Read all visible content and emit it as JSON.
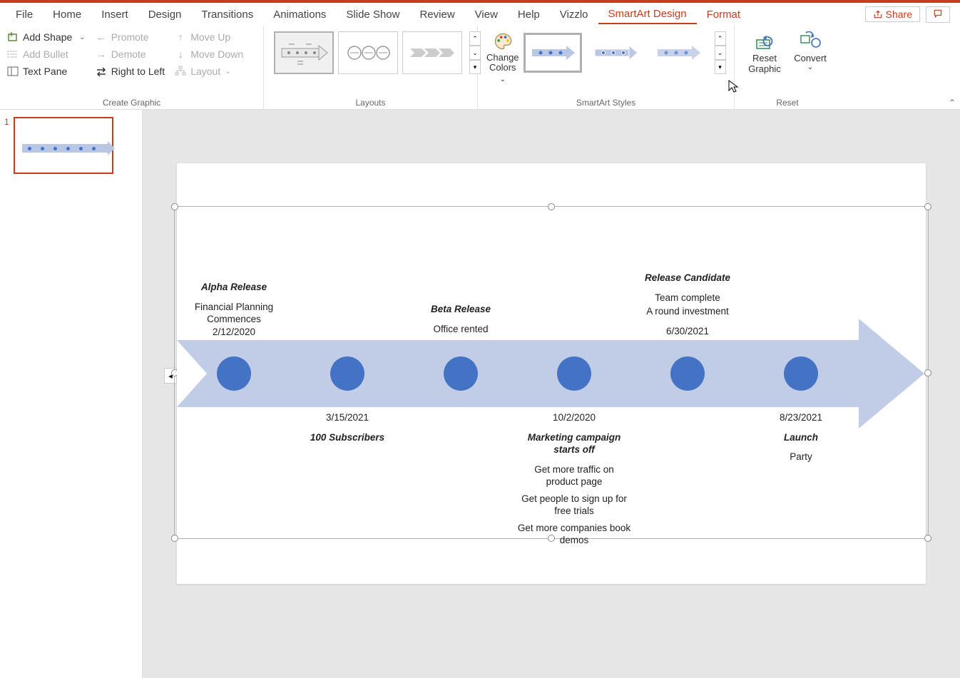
{
  "tabs": {
    "file": "File",
    "home": "Home",
    "insert": "Insert",
    "design": "Design",
    "transitions": "Transitions",
    "animations": "Animations",
    "slideshow": "Slide Show",
    "review": "Review",
    "view": "View",
    "help": "Help",
    "vizzlo": "Vizzlo",
    "smartart": "SmartArt Design",
    "format": "Format"
  },
  "share": "Share",
  "ribbon": {
    "create_graphic": {
      "add_shape": "Add Shape",
      "add_bullet": "Add Bullet",
      "text_pane": "Text Pane",
      "promote": "Promote",
      "demote": "Demote",
      "rtl": "Right to Left",
      "move_up": "Move Up",
      "move_down": "Move Down",
      "layout": "Layout",
      "label": "Create Graphic"
    },
    "layouts": {
      "label": "Layouts"
    },
    "styles": {
      "change_colors": "Change Colors",
      "label": "SmartArt Styles"
    },
    "reset": {
      "reset_graphic_l1": "Reset",
      "reset_graphic_l2": "Graphic",
      "convert": "Convert",
      "label": "Reset"
    }
  },
  "thumb": {
    "num": "1"
  },
  "timeline": {
    "m0": {
      "title": "Alpha Release",
      "line1": "Financial Planning Commences",
      "date": "2/12/2020"
    },
    "m1": {
      "date": "3/15/2021",
      "title": "100 Subscribers"
    },
    "m2": {
      "title": "Beta Release",
      "line1": "Office rented"
    },
    "m3": {
      "date": "10/2/2020",
      "title": "Marketing campaign starts off",
      "b1": "Get more traffic on product page",
      "b2": "Get people to sign up for free trials",
      "b3": "Get more companies book demos"
    },
    "m4": {
      "title": "Release Candidate",
      "line1": "Team complete",
      "line2": "A round investment",
      "date": "6/30/2021"
    },
    "m5": {
      "date": "8/23/2021",
      "title": "Launch",
      "line1": "Party"
    }
  },
  "chart_data": {
    "type": "timeline",
    "title": "",
    "milestones": [
      {
        "label_position": "above",
        "title": "Alpha Release",
        "date": "2/12/2020",
        "details": [
          "Financial Planning Commences"
        ]
      },
      {
        "label_position": "below",
        "title": "100 Subscribers",
        "date": "3/15/2021",
        "details": []
      },
      {
        "label_position": "above",
        "title": "Beta Release",
        "date": "",
        "details": [
          "Office rented"
        ]
      },
      {
        "label_position": "below",
        "title": "Marketing campaign starts off",
        "date": "10/2/2020",
        "details": [
          "Get more traffic on product page",
          "Get people to sign up for free trials",
          "Get more companies book demos"
        ]
      },
      {
        "label_position": "above",
        "title": "Release Candidate",
        "date": "6/30/2021",
        "details": [
          "Team complete",
          "A round investment"
        ]
      },
      {
        "label_position": "below",
        "title": "Launch",
        "date": "8/23/2021",
        "details": [
          "Party"
        ]
      }
    ]
  }
}
